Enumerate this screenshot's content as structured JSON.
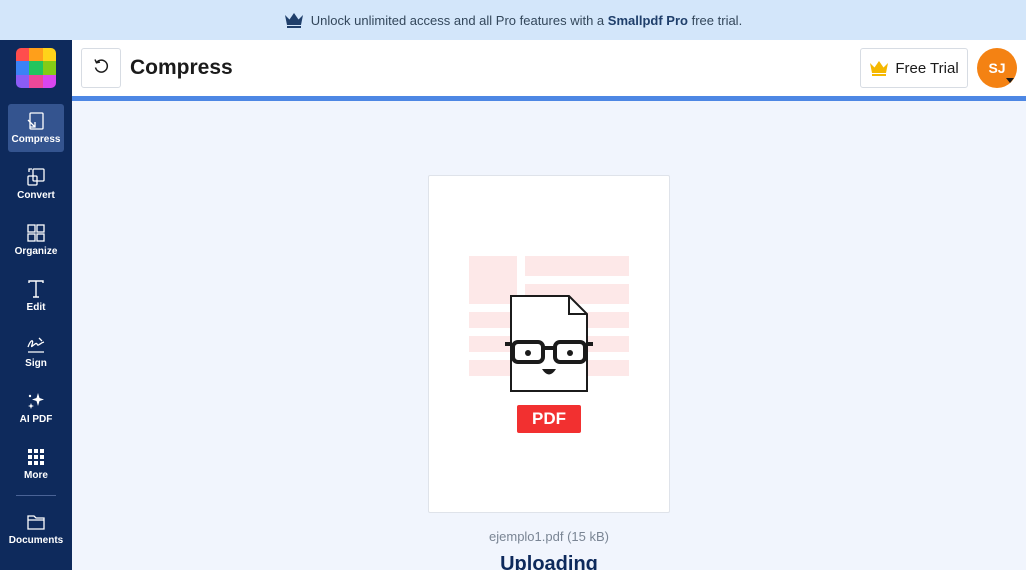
{
  "banner": {
    "text_before": "Unlock unlimited access and all Pro features with a",
    "brand": "Smallpdf Pro",
    "text_after": "free trial.",
    "icon": "crown-icon"
  },
  "logo": {
    "colors": [
      "#ff4d4d",
      "#ff9f1a",
      "#ffd31a",
      "#3b82f6",
      "#22c55e",
      "#84cc16",
      "#8b5cf6",
      "#ec4899",
      "#d946ef"
    ]
  },
  "sidebar": {
    "items": [
      {
        "label": "Compress",
        "icon": "compress-icon",
        "active": true
      },
      {
        "label": "Convert",
        "icon": "convert-icon",
        "active": false
      },
      {
        "label": "Organize",
        "icon": "organize-icon",
        "active": false
      },
      {
        "label": "Edit",
        "icon": "edit-icon",
        "active": false
      },
      {
        "label": "Sign",
        "icon": "sign-icon",
        "active": false
      },
      {
        "label": "AI PDF",
        "icon": "sparkle-icon",
        "active": false
      },
      {
        "label": "More",
        "icon": "grid-icon",
        "active": false
      },
      {
        "label": "Documents",
        "icon": "folder-icon",
        "active": false
      }
    ]
  },
  "header": {
    "title": "Compress",
    "back_icon": "undo-icon",
    "trial_label": "Free Trial",
    "avatar_initials": "SJ"
  },
  "file": {
    "badge": "PDF",
    "name": "ejemplo1.pdf (15 kB)",
    "status": "Uploading"
  },
  "colors": {
    "sidebar": "#0e2a5c",
    "accent": "#4d87e4",
    "avatar": "#f48213",
    "pdf_badge": "#f23030"
  }
}
